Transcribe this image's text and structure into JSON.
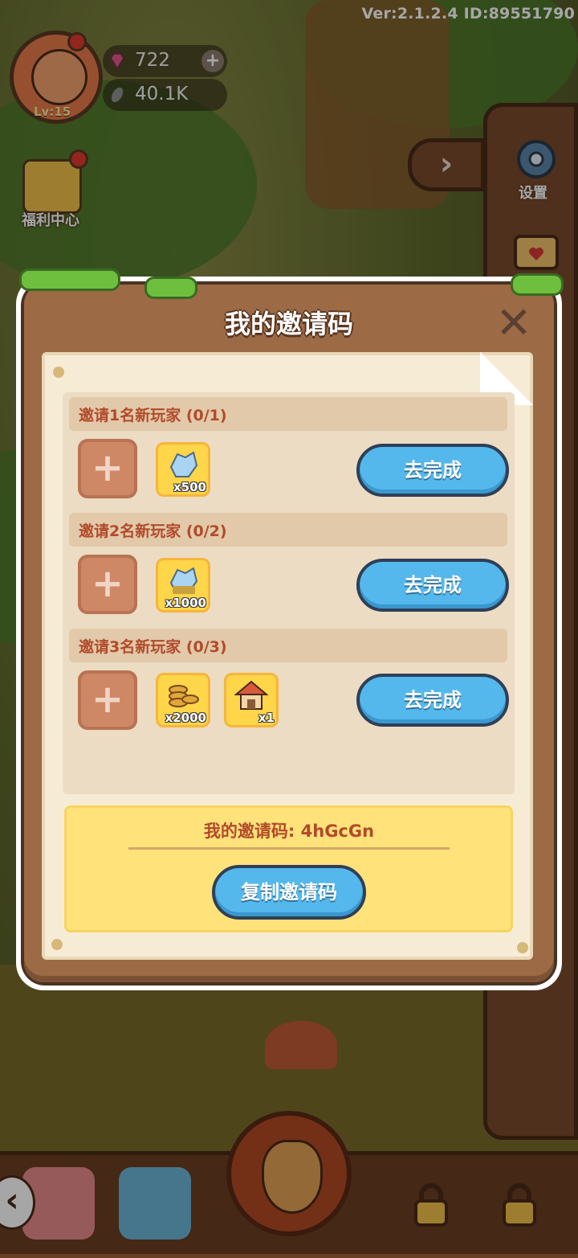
{
  "hud": {
    "version": "Ver:2.1.2.4 ID:89551790",
    "level": "Lv:15",
    "gems": "722",
    "acorns": "40.1K",
    "welfare_label": "福利中心",
    "settings_label": "设置"
  },
  "dialog": {
    "title": "我的邀请码",
    "tasks": [
      {
        "title": "邀请1名新玩家  (0/1)",
        "rewards": [
          {
            "icon": "crystal-icon",
            "qty": "x500"
          }
        ],
        "button": "去完成"
      },
      {
        "title": "邀请2名新玩家  (0/2)",
        "rewards": [
          {
            "icon": "crystal-icon",
            "qty": "x1000"
          }
        ],
        "button": "去完成"
      },
      {
        "title": "邀请3名新玩家  (0/3)",
        "rewards": [
          {
            "icon": "coins-icon",
            "qty": "x2000"
          },
          {
            "icon": "house-icon",
            "qty": "x1"
          }
        ],
        "button": "去完成"
      }
    ],
    "invite_code_text": "我的邀请码: 4hGcGn",
    "copy_button": "复制邀请码"
  },
  "colors": {
    "accent_blue": "#54b8ec",
    "title_red": "#b24a2a",
    "code_box_yellow": "#ffe27a"
  }
}
